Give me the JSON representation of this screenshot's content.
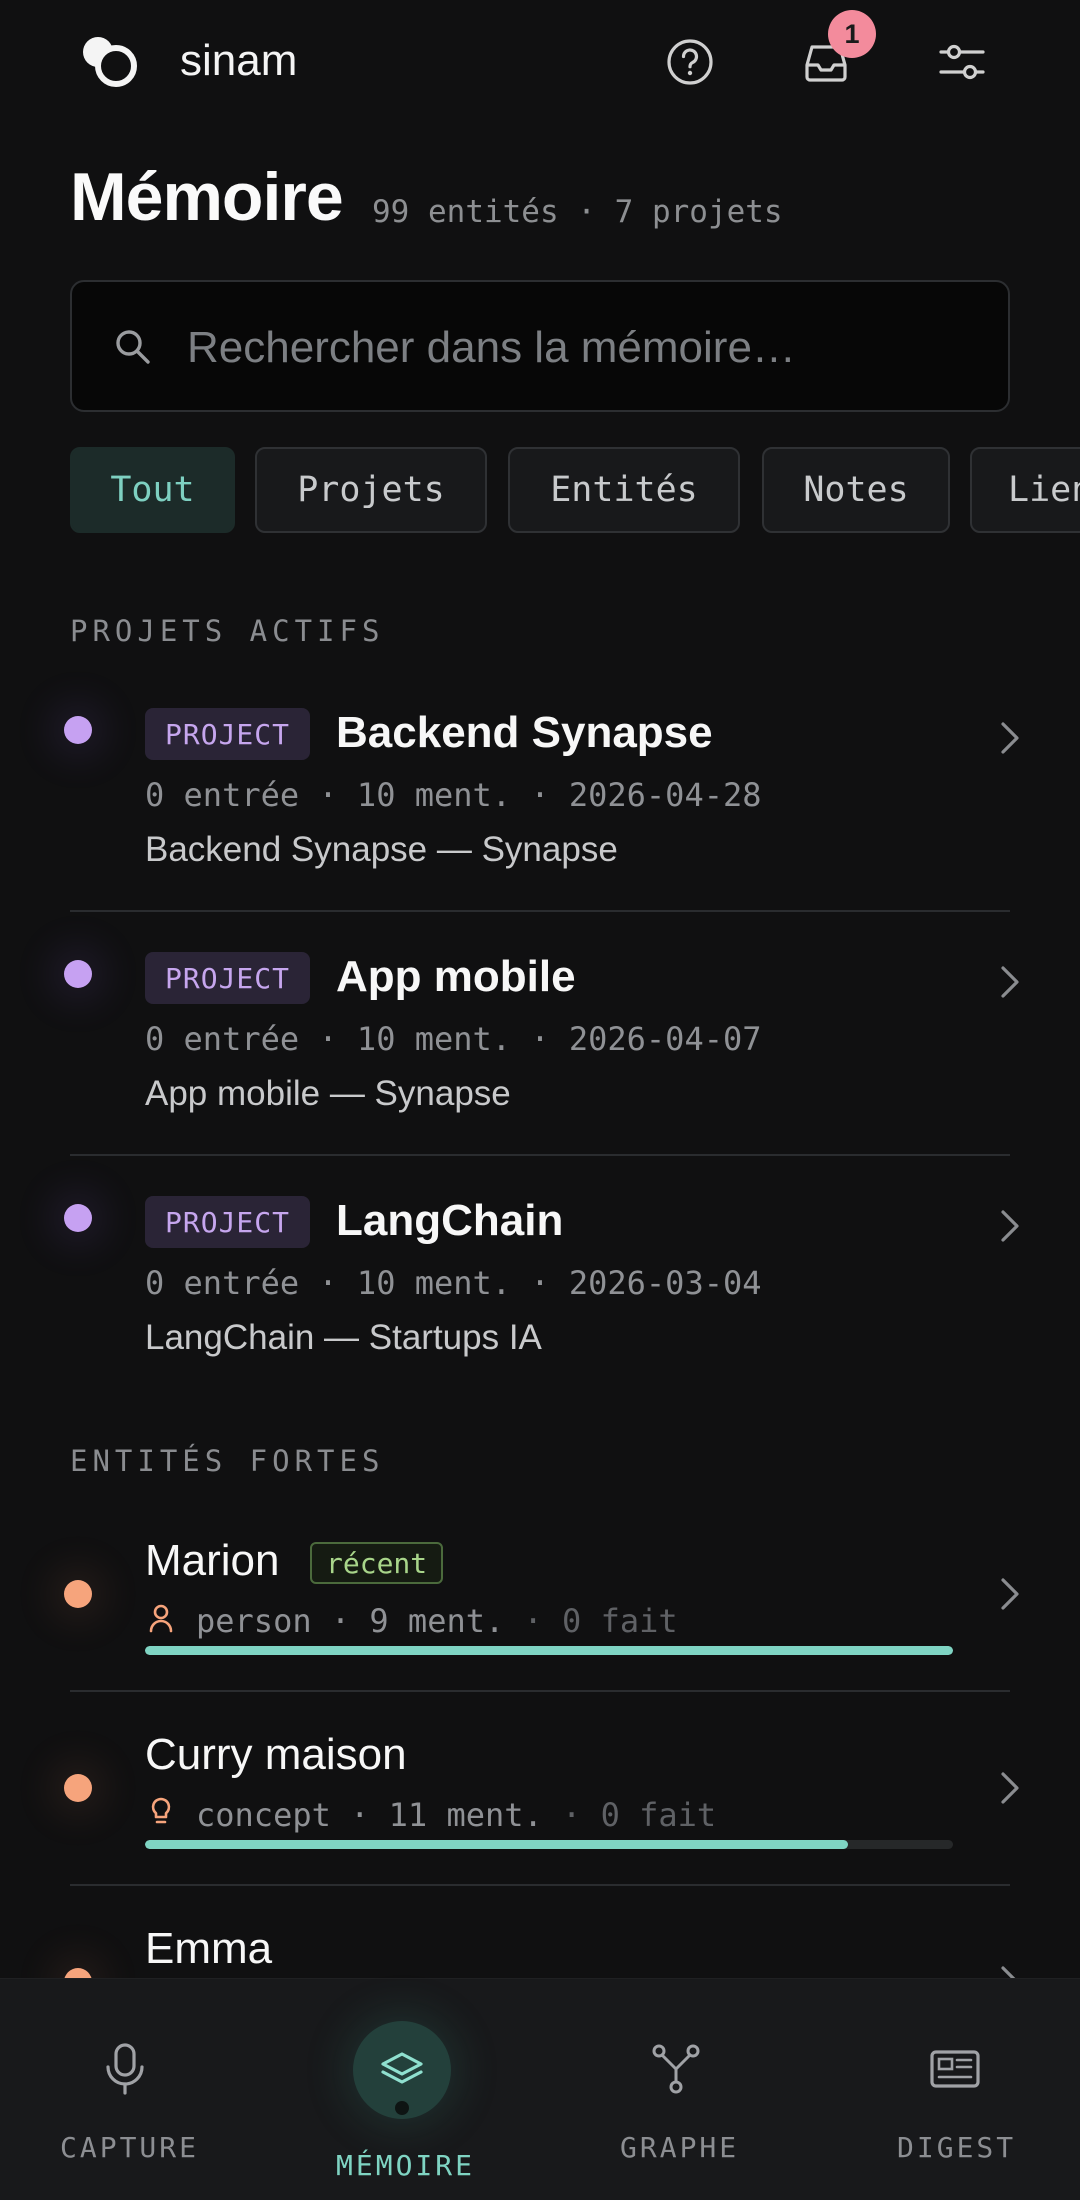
{
  "header": {
    "brand": "sinam",
    "notification_count": "1",
    "icons": [
      "logo-icon",
      "help-icon",
      "inbox-icon",
      "settings-sliders-icon"
    ]
  },
  "page": {
    "title": "Mémoire",
    "subtitle": "99 entités · 7 projets"
  },
  "search": {
    "placeholder": "Rechercher dans la mémoire…",
    "value": ""
  },
  "filters": {
    "selected": "Tout",
    "items": [
      "Tout",
      "Projets",
      "Entités",
      "Notes",
      "Liens"
    ]
  },
  "projects_section": {
    "title": "PROJETS ACTIFS",
    "items": [
      {
        "tag": "PROJECT",
        "name": "Backend Synapse",
        "meta": "0 entrée · 10 ment. · 2026-04-28",
        "description": "Backend Synapse — Synapse"
      },
      {
        "tag": "PROJECT",
        "name": "App mobile",
        "meta": "0 entrée · 10 ment. · 2026-04-07",
        "description": "App mobile — Synapse"
      },
      {
        "tag": "PROJECT",
        "name": "LangChain",
        "meta": "0 entrée · 10 ment. · 2026-03-04",
        "description": "LangChain — Startups IA"
      }
    ]
  },
  "entities_section": {
    "title": "ENTITÉS FORTES",
    "items": [
      {
        "name": "Marion",
        "badge": "récent",
        "icon": "person-icon",
        "kind": "person",
        "mentions": "9 ment.",
        "facts": "0 fait",
        "strength": 1.0
      },
      {
        "name": "Curry maison",
        "badge": "",
        "icon": "lightbulb-icon",
        "kind": "concept",
        "mentions": "11 ment.",
        "facts": "0 fait",
        "strength": 0.87
      },
      {
        "name": "Emma",
        "badge": "",
        "icon": "",
        "kind": "",
        "mentions": "",
        "facts": "",
        "strength": 0
      }
    ]
  },
  "nav": {
    "active": "MÉMOIRE",
    "items": [
      {
        "label": "CAPTURE",
        "icon": "microphone-icon"
      },
      {
        "label": "MÉMOIRE",
        "icon": "layers-icon"
      },
      {
        "label": "GRAPHE",
        "icon": "graph-icon"
      },
      {
        "label": "DIGEST",
        "icon": "newspaper-icon"
      }
    ]
  },
  "colors": {
    "background": "#101011",
    "accent_teal": "#7fd4c3",
    "project_purple": "#c6a1f2",
    "entity_orange": "#f6a47c",
    "badge_pink": "#f38b9c",
    "recent_green": "#a8d58a"
  }
}
